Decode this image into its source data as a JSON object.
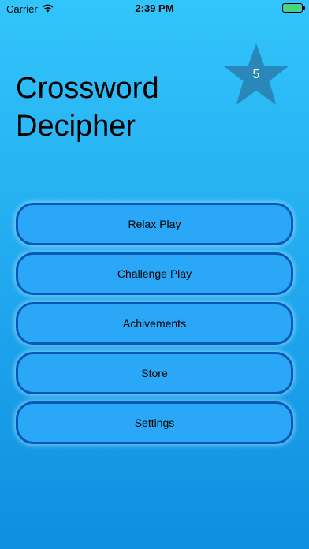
{
  "status_bar": {
    "carrier": "Carrier",
    "time": "2:39 PM"
  },
  "title": "Crossword Decipher",
  "star_badge": {
    "count": "5",
    "color": "#2a87ba"
  },
  "menu": {
    "items": [
      {
        "label": "Relax Play"
      },
      {
        "label": "Challenge Play"
      },
      {
        "label": "Achivements"
      },
      {
        "label": "Store"
      },
      {
        "label": "Settings"
      }
    ]
  },
  "colors": {
    "button_fill": "#2aa7f7",
    "button_border": "#0a58b5",
    "background_top": "#32c5fb",
    "background_bottom": "#0f8fdf"
  }
}
